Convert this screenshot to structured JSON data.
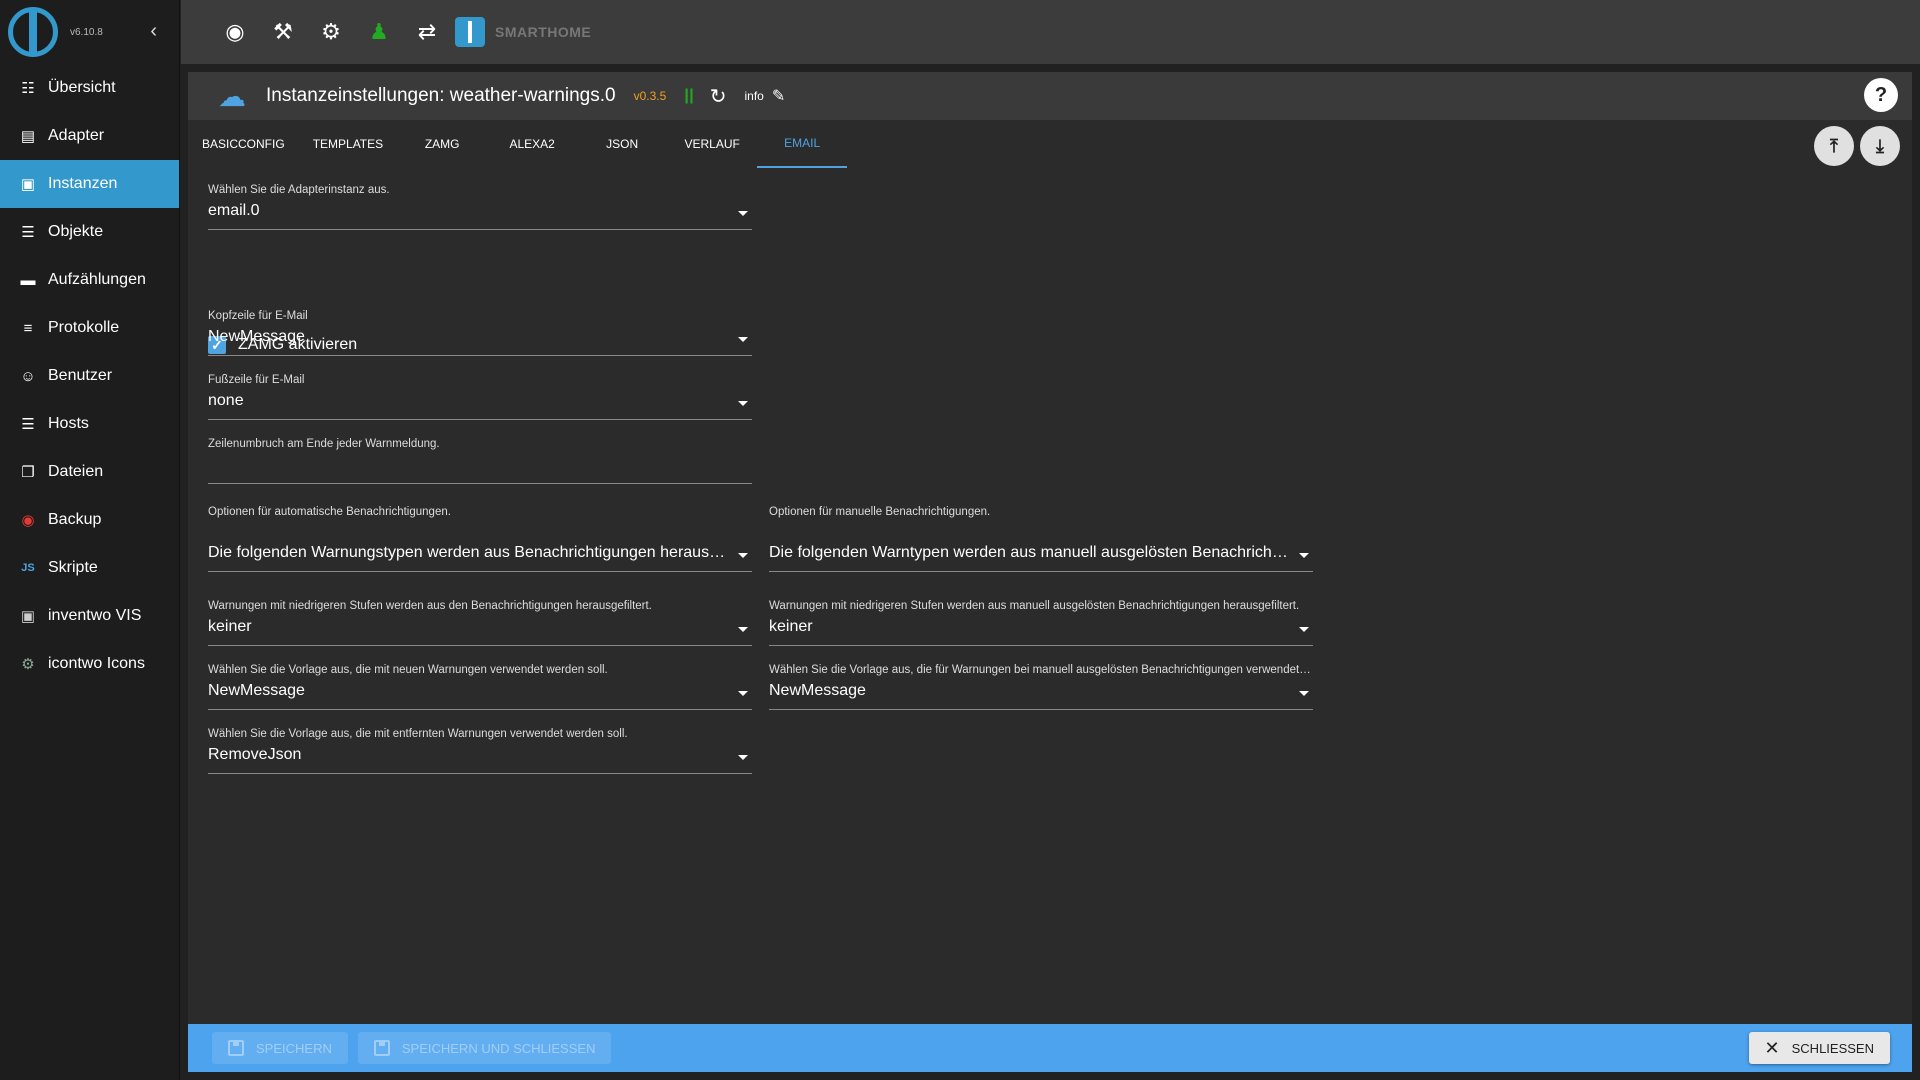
{
  "sidebar": {
    "version": "v6.10.8",
    "collapse_icon": "chevron-left-icon",
    "items": [
      {
        "label": "Übersicht",
        "icon": "grid-icon"
      },
      {
        "label": "Adapter",
        "icon": "store-icon"
      },
      {
        "label": "Instanzen",
        "icon": "instances-icon"
      },
      {
        "label": "Objekte",
        "icon": "list-icon"
      },
      {
        "label": "Aufzählungen",
        "icon": "enum-icon"
      },
      {
        "label": "Protokolle",
        "icon": "log-icon"
      },
      {
        "label": "Benutzer",
        "icon": "user-icon"
      },
      {
        "label": "Hosts",
        "icon": "server-icon"
      },
      {
        "label": "Dateien",
        "icon": "file-icon"
      },
      {
        "label": "Backup",
        "icon": "backup-icon"
      },
      {
        "label": "Skripte",
        "icon": "js-icon"
      },
      {
        "label": "inventwo VIS",
        "icon": "vis-icon"
      },
      {
        "label": "icontwo Icons",
        "icon": "icontwo-icon"
      }
    ],
    "active_index": 2
  },
  "topbar": {
    "icons": [
      "eye-icon",
      "wrench-icon",
      "gear-icon",
      "expert-mode-icon",
      "sync-icon"
    ],
    "brand": "SMARTHOME"
  },
  "panel": {
    "title": "Instanzeinstellungen: weather-warnings.0",
    "version": "v0.3.5",
    "info": "info",
    "help": "?"
  },
  "tabs": [
    {
      "label": "BASICCONFIG"
    },
    {
      "label": "TEMPLATES"
    },
    {
      "label": "ZAMG"
    },
    {
      "label": "ALEXA2"
    },
    {
      "label": "JSON"
    },
    {
      "label": "VERLAUF"
    },
    {
      "label": "EMAIL"
    }
  ],
  "active_tab": 6,
  "form": {
    "instance": {
      "label": "Wählen Sie die Adapterinstanz aus.",
      "value": "email.0"
    },
    "zamg": {
      "label": "ZAMG aktivieren",
      "checked": true
    },
    "header": {
      "label": "Kopfzeile für E-Mail",
      "value": "NewMessage"
    },
    "footer": {
      "label": "Fußzeile für E-Mail",
      "value": "none"
    },
    "linebreak": {
      "label": "Zeilenumbruch am Ende jeder Warnmeldung.",
      "value": ""
    },
    "auto_section": "Optionen für automatische Benachrichtigungen.",
    "manual_section": "Optionen für manuelle Benachrichtigungen.",
    "auto_filter_types": {
      "value": "Die folgenden Warnungstypen werden aus Benachrichtigungen herausgefiltert"
    },
    "manual_filter_types": {
      "value": "Die folgenden Warntypen werden aus manuell ausgelösten Benachrichtigungen herausgefiltert"
    },
    "auto_level": {
      "label": "Warnungen mit niedrigeren Stufen werden aus den Benachrichtigungen herausgefiltert.",
      "value": "keiner"
    },
    "manual_level": {
      "label": "Warnungen mit niedrigeren Stufen werden aus manuell ausgelösten Benachrichtigungen herausgefiltert.",
      "value": "keiner"
    },
    "auto_new_template": {
      "label": "Wählen Sie die Vorlage aus, die mit neuen Warnungen verwendet werden soll.",
      "value": "NewMessage"
    },
    "manual_template": {
      "label": "Wählen Sie die Vorlage aus, die für Warnungen bei manuell ausgelösten Benachrichtigungen verwendet werden soll.",
      "value": "NewMessage"
    },
    "auto_remove_template": {
      "label": "Wählen Sie die Vorlage aus, die mit entfernten Warnungen verwendet werden soll.",
      "value": "RemoveJson"
    }
  },
  "footer": {
    "save": "SPEICHERN",
    "save_close": "SPEICHERN UND SCHLIESSEN",
    "close": "SCHLIESSEN"
  },
  "colors": {
    "accent": "#3399cc",
    "tab_active": "#4fa3e0",
    "version": "#f0a020",
    "footer_bg": "#4da3ee"
  }
}
